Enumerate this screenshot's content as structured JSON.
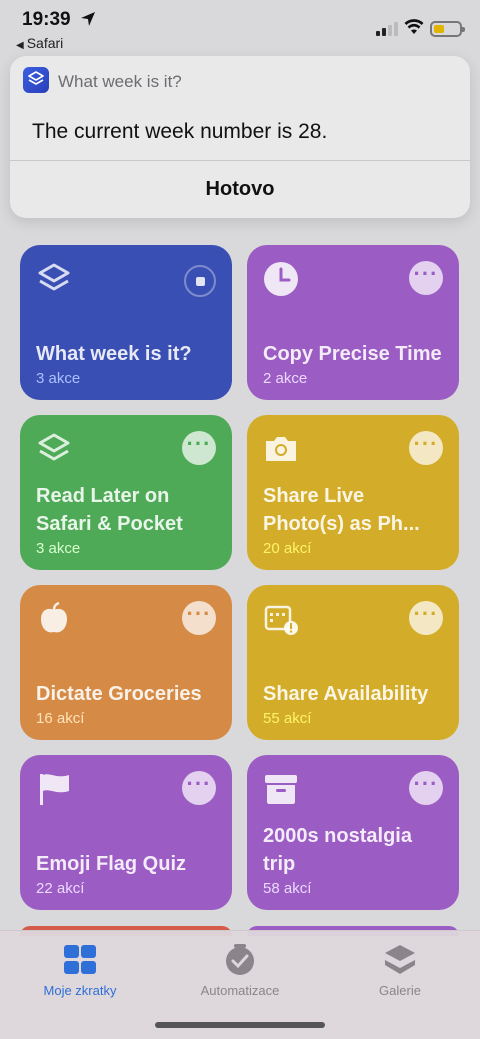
{
  "status_bar": {
    "time": "19:39",
    "back_app": "Safari",
    "battery_color": "#e0b400"
  },
  "notification": {
    "app_icon": "shortcuts-icon",
    "title": "What week is it?",
    "message": "The current week number is 28.",
    "done_label": "Hotovo"
  },
  "shortcuts": [
    {
      "name": "What week is it?",
      "count": "3 akce",
      "icon": "shortcuts-layers-icon",
      "color": "#3a4fb3",
      "state": "running"
    },
    {
      "name": "Copy Precise Time",
      "count": "2 akce",
      "icon": "clock-icon",
      "color": "#9b5cc4",
      "state": "idle"
    },
    {
      "name": "Read Later on Safari & Pocket",
      "count": "3 akce",
      "icon": "shortcuts-layers-icon",
      "color": "#4faa57",
      "state": "idle"
    },
    {
      "name": "Share Live Photo(s) as Ph...",
      "count": "20 akcí",
      "icon": "camera-icon",
      "color": "#d3ad2a",
      "state": "idle"
    },
    {
      "name": "Dictate Groceries",
      "count": "16 akcí",
      "icon": "apple-icon",
      "color": "#d58b45",
      "state": "idle"
    },
    {
      "name": "Share Availability",
      "count": "55 akcí",
      "icon": "calendar-alert-icon",
      "color": "#d3ad2a",
      "state": "idle"
    },
    {
      "name": "Emoji Flag Quiz",
      "count": "22 akcí",
      "icon": "flag-icon",
      "color": "#9b5cc4",
      "state": "idle"
    },
    {
      "name": "2000s nostalgia trip",
      "count": "58 akcí",
      "icon": "archive-box-icon",
      "color": "#9b5cc4",
      "state": "idle"
    }
  ],
  "tabbar": {
    "tabs": [
      {
        "label": "Moje zkratky",
        "icon": "grid-icon",
        "active": true
      },
      {
        "label": "Automatizace",
        "icon": "clock-check-icon",
        "active": false
      },
      {
        "label": "Galerie",
        "icon": "layers-icon",
        "active": false
      }
    ],
    "active_color": "#2f6fd8",
    "inactive_color": "#8a858a"
  }
}
